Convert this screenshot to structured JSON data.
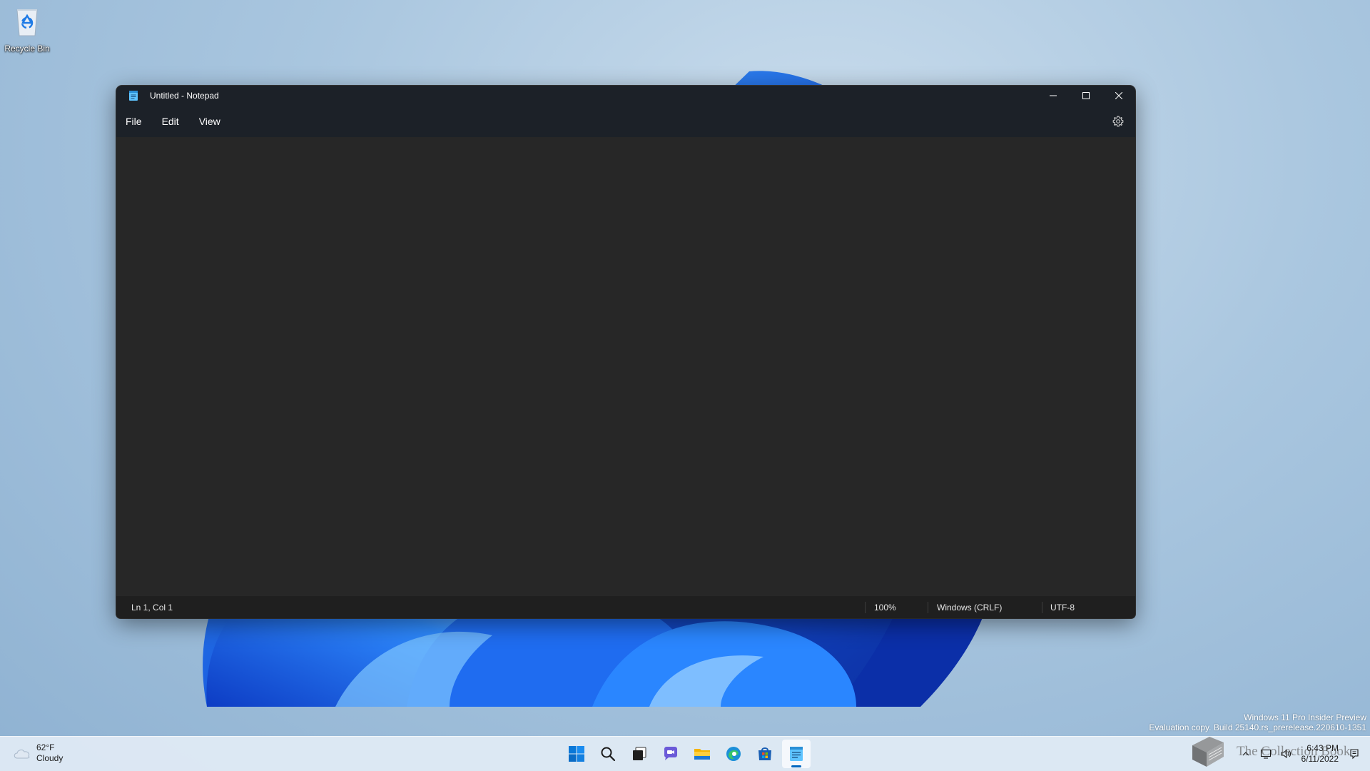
{
  "desktop": {
    "icons": [
      {
        "label": "Recycle Bin",
        "icon": "recycle-bin-icon"
      }
    ],
    "watermark": {
      "line1": "Windows 11 Pro Insider Preview",
      "line2": "Evaluation copy. Build 25140.rs_prerelease.220610-1351"
    }
  },
  "window": {
    "title": "Untitled - Notepad",
    "app_icon": "notepad-icon",
    "caption": {
      "minimize": "minimize-icon",
      "maximize": "maximize-icon",
      "close": "close-icon"
    },
    "menu": {
      "items": [
        {
          "label": "File"
        },
        {
          "label": "Edit"
        },
        {
          "label": "View"
        }
      ],
      "settings_icon": "gear-icon"
    },
    "editor": {
      "content": ""
    },
    "status": {
      "position": "Ln 1, Col 1",
      "zoom": "100%",
      "line_ending": "Windows (CRLF)",
      "encoding": "UTF-8"
    },
    "colors": {
      "titlebar": "#1c2128",
      "editor": "#272727",
      "statusbar": "#1f1f1f"
    }
  },
  "taskbar": {
    "weather": {
      "temperature": "62°F",
      "condition": "Cloudy",
      "icon": "cloudy-icon"
    },
    "apps": [
      {
        "name": "start-icon"
      },
      {
        "name": "search-icon"
      },
      {
        "name": "task-view-icon"
      },
      {
        "name": "teams-chat-icon"
      },
      {
        "name": "file-explorer-icon"
      },
      {
        "name": "edge-icon"
      },
      {
        "name": "store-icon"
      },
      {
        "name": "notepad-icon",
        "active": true
      }
    ],
    "tray": {
      "overlay_logo": "book-icon",
      "overlay_text": "The Collection Book",
      "time": "6:43 PM",
      "date": "6/11/2022"
    },
    "accent": "#0067c0"
  }
}
